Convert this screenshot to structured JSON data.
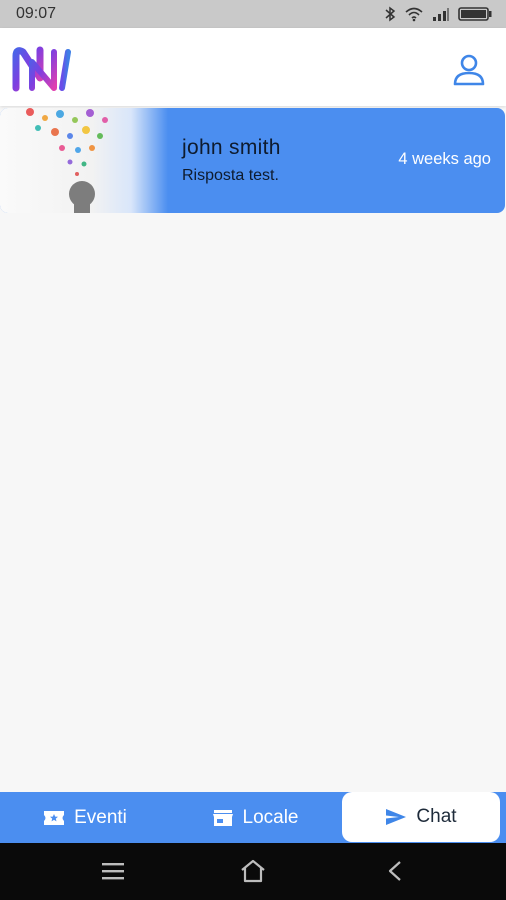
{
  "status_bar": {
    "time": "09:07"
  },
  "app_bar": {
    "logo_icon": "nt-logo",
    "profile_icon": "user-icon"
  },
  "chats": [
    {
      "name": "john smith",
      "last_message": "Risposta test.",
      "time_ago": "4 weeks ago"
    }
  ],
  "bottom_nav": {
    "items": [
      {
        "label": "Eventi",
        "icon": "ticket-icon",
        "active": false
      },
      {
        "label": "Locale",
        "icon": "store-icon",
        "active": false
      },
      {
        "label": "Chat",
        "icon": "send-icon",
        "active": true
      }
    ]
  },
  "colors": {
    "accent": "#4b8ef0",
    "status_bar": "#c9c9c9",
    "system_nav": "#0a0a0a",
    "background": "#f7f7f7"
  }
}
